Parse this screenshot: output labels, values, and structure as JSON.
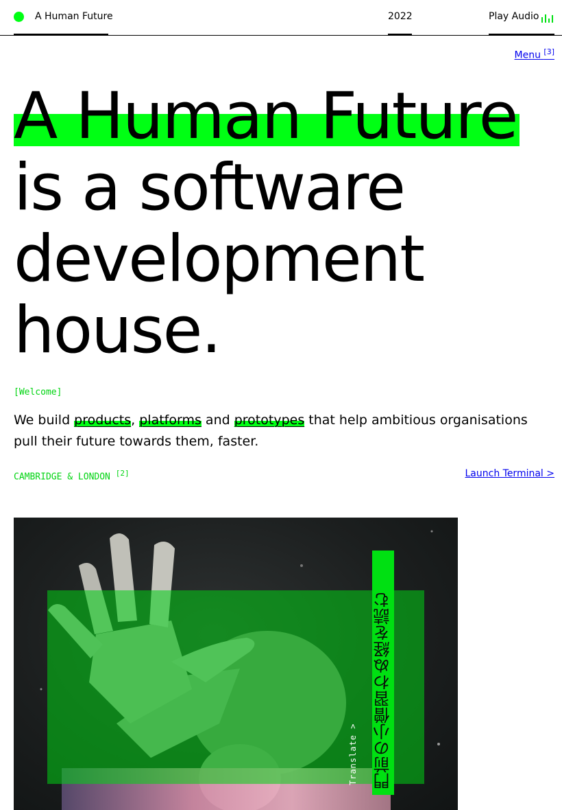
{
  "header": {
    "brand": "A Human Future",
    "year": "2022",
    "play_audio": "Play Audio",
    "audio_icon": "audio-bars-icon"
  },
  "nav": {
    "menu_label": "Menu",
    "menu_sup": "[3]"
  },
  "hero": {
    "line1": "A Human Future",
    "line2": "is a software",
    "line3": "development",
    "line4": "house."
  },
  "intro": {
    "tag": "[Welcome]",
    "text_1": "We build ",
    "word_products": "products",
    "text_2": ", ",
    "word_platforms": "platforms",
    "text_3": " and ",
    "word_prototypes": "prototypes",
    "text_4": " that help ambitious organisations pull their future towards them, faster."
  },
  "location": {
    "label": "CAMBRIDGE & LONDON",
    "sup": "[2]"
  },
  "terminal": {
    "label": "Launch Terminal  >"
  },
  "feature": {
    "japanese": "門前の小僧習わぬ経を読む",
    "translate": "Translate >"
  },
  "colors": {
    "accent": "#00ff14",
    "link": "#0000ee",
    "text": "#000000"
  }
}
